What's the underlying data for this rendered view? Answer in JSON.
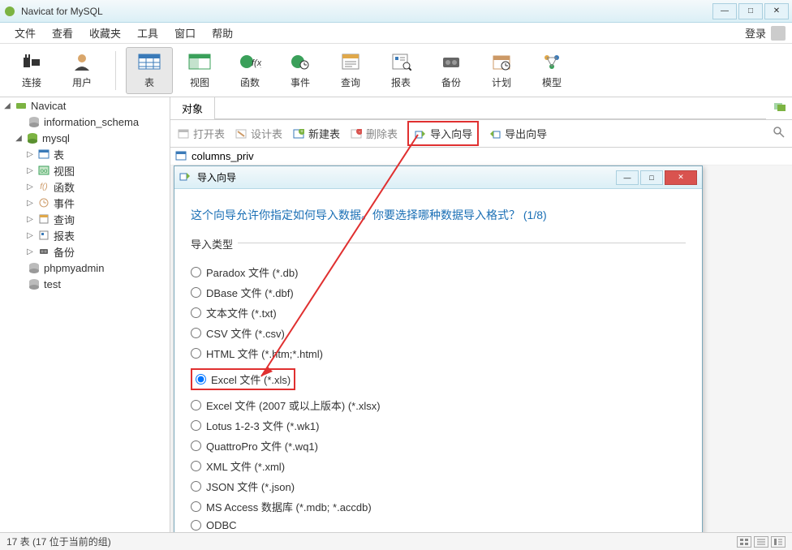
{
  "app": {
    "title": "Navicat for MySQL"
  },
  "menu": {
    "items": [
      "文件",
      "查看",
      "收藏夹",
      "工具",
      "窗口",
      "帮助"
    ],
    "login": "登录"
  },
  "toolbar": {
    "items": [
      {
        "label": "连接",
        "icon": "plug"
      },
      {
        "label": "用户",
        "icon": "user"
      },
      {
        "label": "表",
        "icon": "table",
        "active": true
      },
      {
        "label": "视图",
        "icon": "view"
      },
      {
        "label": "函数",
        "icon": "fx"
      },
      {
        "label": "事件",
        "icon": "event"
      },
      {
        "label": "查询",
        "icon": "query"
      },
      {
        "label": "报表",
        "icon": "report"
      },
      {
        "label": "备份",
        "icon": "backup"
      },
      {
        "label": "计划",
        "icon": "schedule"
      },
      {
        "label": "模型",
        "icon": "model"
      }
    ]
  },
  "sidebar": {
    "root": {
      "label": "Navicat",
      "expanded": true
    },
    "children": [
      {
        "label": "information_schema",
        "icon": "db"
      },
      {
        "label": "mysql",
        "icon": "db-open",
        "expanded": true,
        "children": [
          {
            "label": "表",
            "icon": "table"
          },
          {
            "label": "视图",
            "icon": "view"
          },
          {
            "label": "函数",
            "icon": "fx"
          },
          {
            "label": "事件",
            "icon": "event"
          },
          {
            "label": "查询",
            "icon": "query"
          },
          {
            "label": "报表",
            "icon": "report"
          },
          {
            "label": "备份",
            "icon": "backup"
          }
        ]
      },
      {
        "label": "phpmyadmin",
        "icon": "db"
      },
      {
        "label": "test",
        "icon": "db"
      }
    ]
  },
  "objectTabs": {
    "tab1": "对象"
  },
  "objectToolbar": {
    "open": "打开表",
    "design": "设计表",
    "new": "新建表",
    "delete": "删除表",
    "import": "导入向导",
    "export": "导出向导"
  },
  "objectList": {
    "item1": "columns_priv"
  },
  "wizard": {
    "title": "导入向导",
    "heading": "这个向导允许你指定如何导入数据。你要选择哪种数据导入格式？ (1/8)",
    "groupLabel": "导入类型",
    "options": [
      "Paradox 文件 (*.db)",
      "DBase 文件 (*.dbf)",
      "文本文件 (*.txt)",
      "CSV 文件 (*.csv)",
      "HTML 文件 (*.htm;*.html)",
      "Excel 文件 (*.xls)",
      "Excel 文件 (2007 或以上版本) (*.xlsx)",
      "Lotus 1-2-3 文件 (*.wk1)",
      "QuattroPro 文件 (*.wq1)",
      "XML 文件 (*.xml)",
      "JSON 文件 (*.json)",
      "MS Access 数据库 (*.mdb; *.accdb)",
      "ODBC"
    ],
    "selectedIndex": 5
  },
  "status": {
    "text": "17 表 (17 位于当前的组)"
  }
}
